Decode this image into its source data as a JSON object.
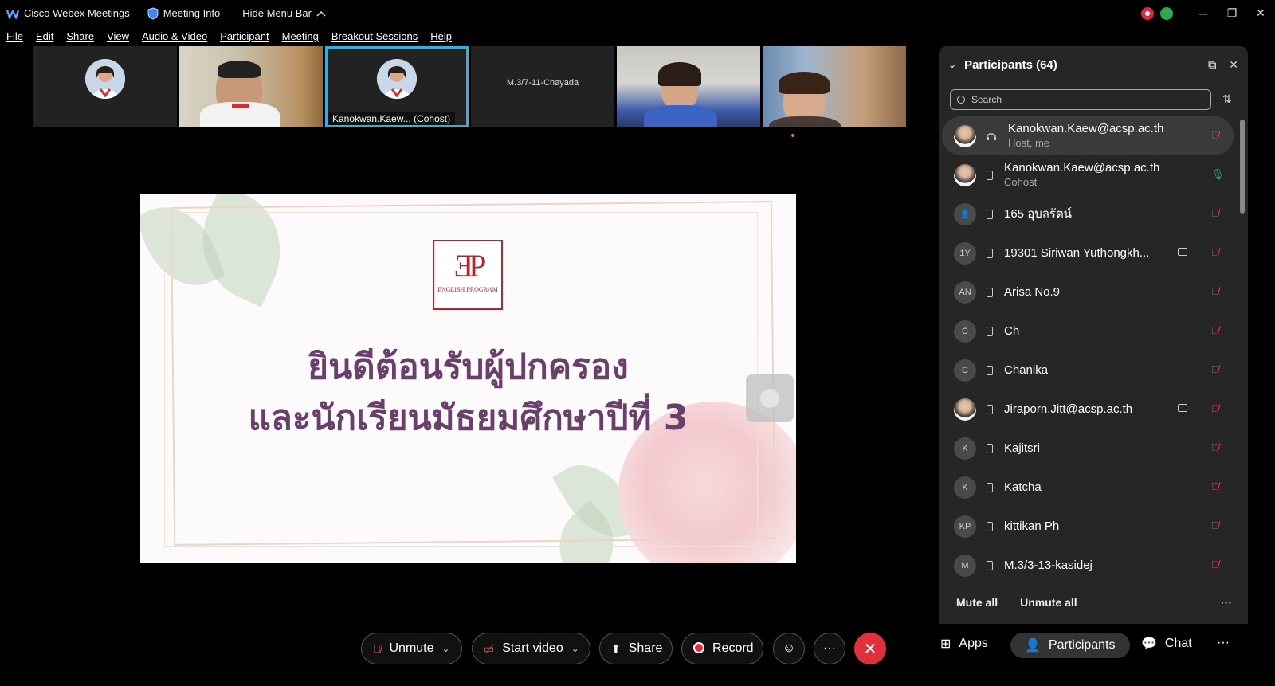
{
  "titlebar": {
    "app_name": "Cisco Webex Meetings",
    "meeting_info": "Meeting Info",
    "hide_menu": "Hide Menu Bar"
  },
  "menu": [
    "File",
    "Edit",
    "Share",
    "View",
    "Audio & Video",
    "Participant",
    "Meeting",
    "Breakout Sessions",
    "Help"
  ],
  "video_strip": {
    "tiles": [
      {
        "name": ""
      },
      {
        "name": ""
      },
      {
        "name": "Kanokwan.Kaew...  (Cohost)"
      },
      {
        "name": "M.3/7-11-Chayada"
      },
      {
        "name": ""
      },
      {
        "name": ""
      }
    ]
  },
  "slide": {
    "logo_text": "ENGLISH PROGRAM",
    "line1": "ยินดีต้อนรับผู้ปกครอง",
    "line2": "และนักเรียนมัธยมศึกษาปีที่ 3"
  },
  "participants_panel": {
    "title": "Participants (64)",
    "search_placeholder": "Search",
    "mute_all": "Mute all",
    "unmute_all": "Unmute all",
    "more": "···",
    "list": [
      {
        "name": "Kanokwan.Kaew@acsp.ac.th",
        "role": "Host, me",
        "avatar": "",
        "muted": true,
        "video": false
      },
      {
        "name": "Kanokwan.Kaew@acsp.ac.th",
        "role": "Cohost",
        "avatar": "",
        "muted": false,
        "video": false
      },
      {
        "name": "165 อุบลรัตน์",
        "role": "",
        "avatar": "",
        "muted": true,
        "video": false
      },
      {
        "name": "19301 Siriwan Yuthongkh...",
        "role": "",
        "avatar": "1Y",
        "muted": true,
        "video": true
      },
      {
        "name": "Arisa No.9",
        "role": "",
        "avatar": "AN",
        "muted": true,
        "video": false
      },
      {
        "name": "Ch",
        "role": "",
        "avatar": "C",
        "muted": true,
        "video": false
      },
      {
        "name": "Chanika",
        "role": "",
        "avatar": "C",
        "muted": true,
        "video": false
      },
      {
        "name": "Jiraporn.Jitt@acsp.ac.th",
        "role": "",
        "avatar": "",
        "muted": true,
        "video": true
      },
      {
        "name": "Kajitsri",
        "role": "",
        "avatar": "K",
        "muted": true,
        "video": false
      },
      {
        "name": "Katcha",
        "role": "",
        "avatar": "K",
        "muted": true,
        "video": false
      },
      {
        "name": "kittikan Ph",
        "role": "",
        "avatar": "KP",
        "muted": true,
        "video": false
      },
      {
        "name": "M.3/3-13-kasidej",
        "role": "",
        "avatar": "M",
        "muted": true,
        "video": false
      }
    ]
  },
  "toolbar": {
    "unmute": "Unmute",
    "start_video": "Start video",
    "share": "Share",
    "record": "Record",
    "more": "···",
    "apps": "Apps",
    "participants": "Participants",
    "chat": "Chat",
    "overflow": "···"
  },
  "colors": {
    "accent_blue": "#2fb0e5",
    "end_red": "#e0303b",
    "muted_red": "#e0475f",
    "mic_green": "#2fa84f",
    "slide_text": "#6b3f6b"
  }
}
